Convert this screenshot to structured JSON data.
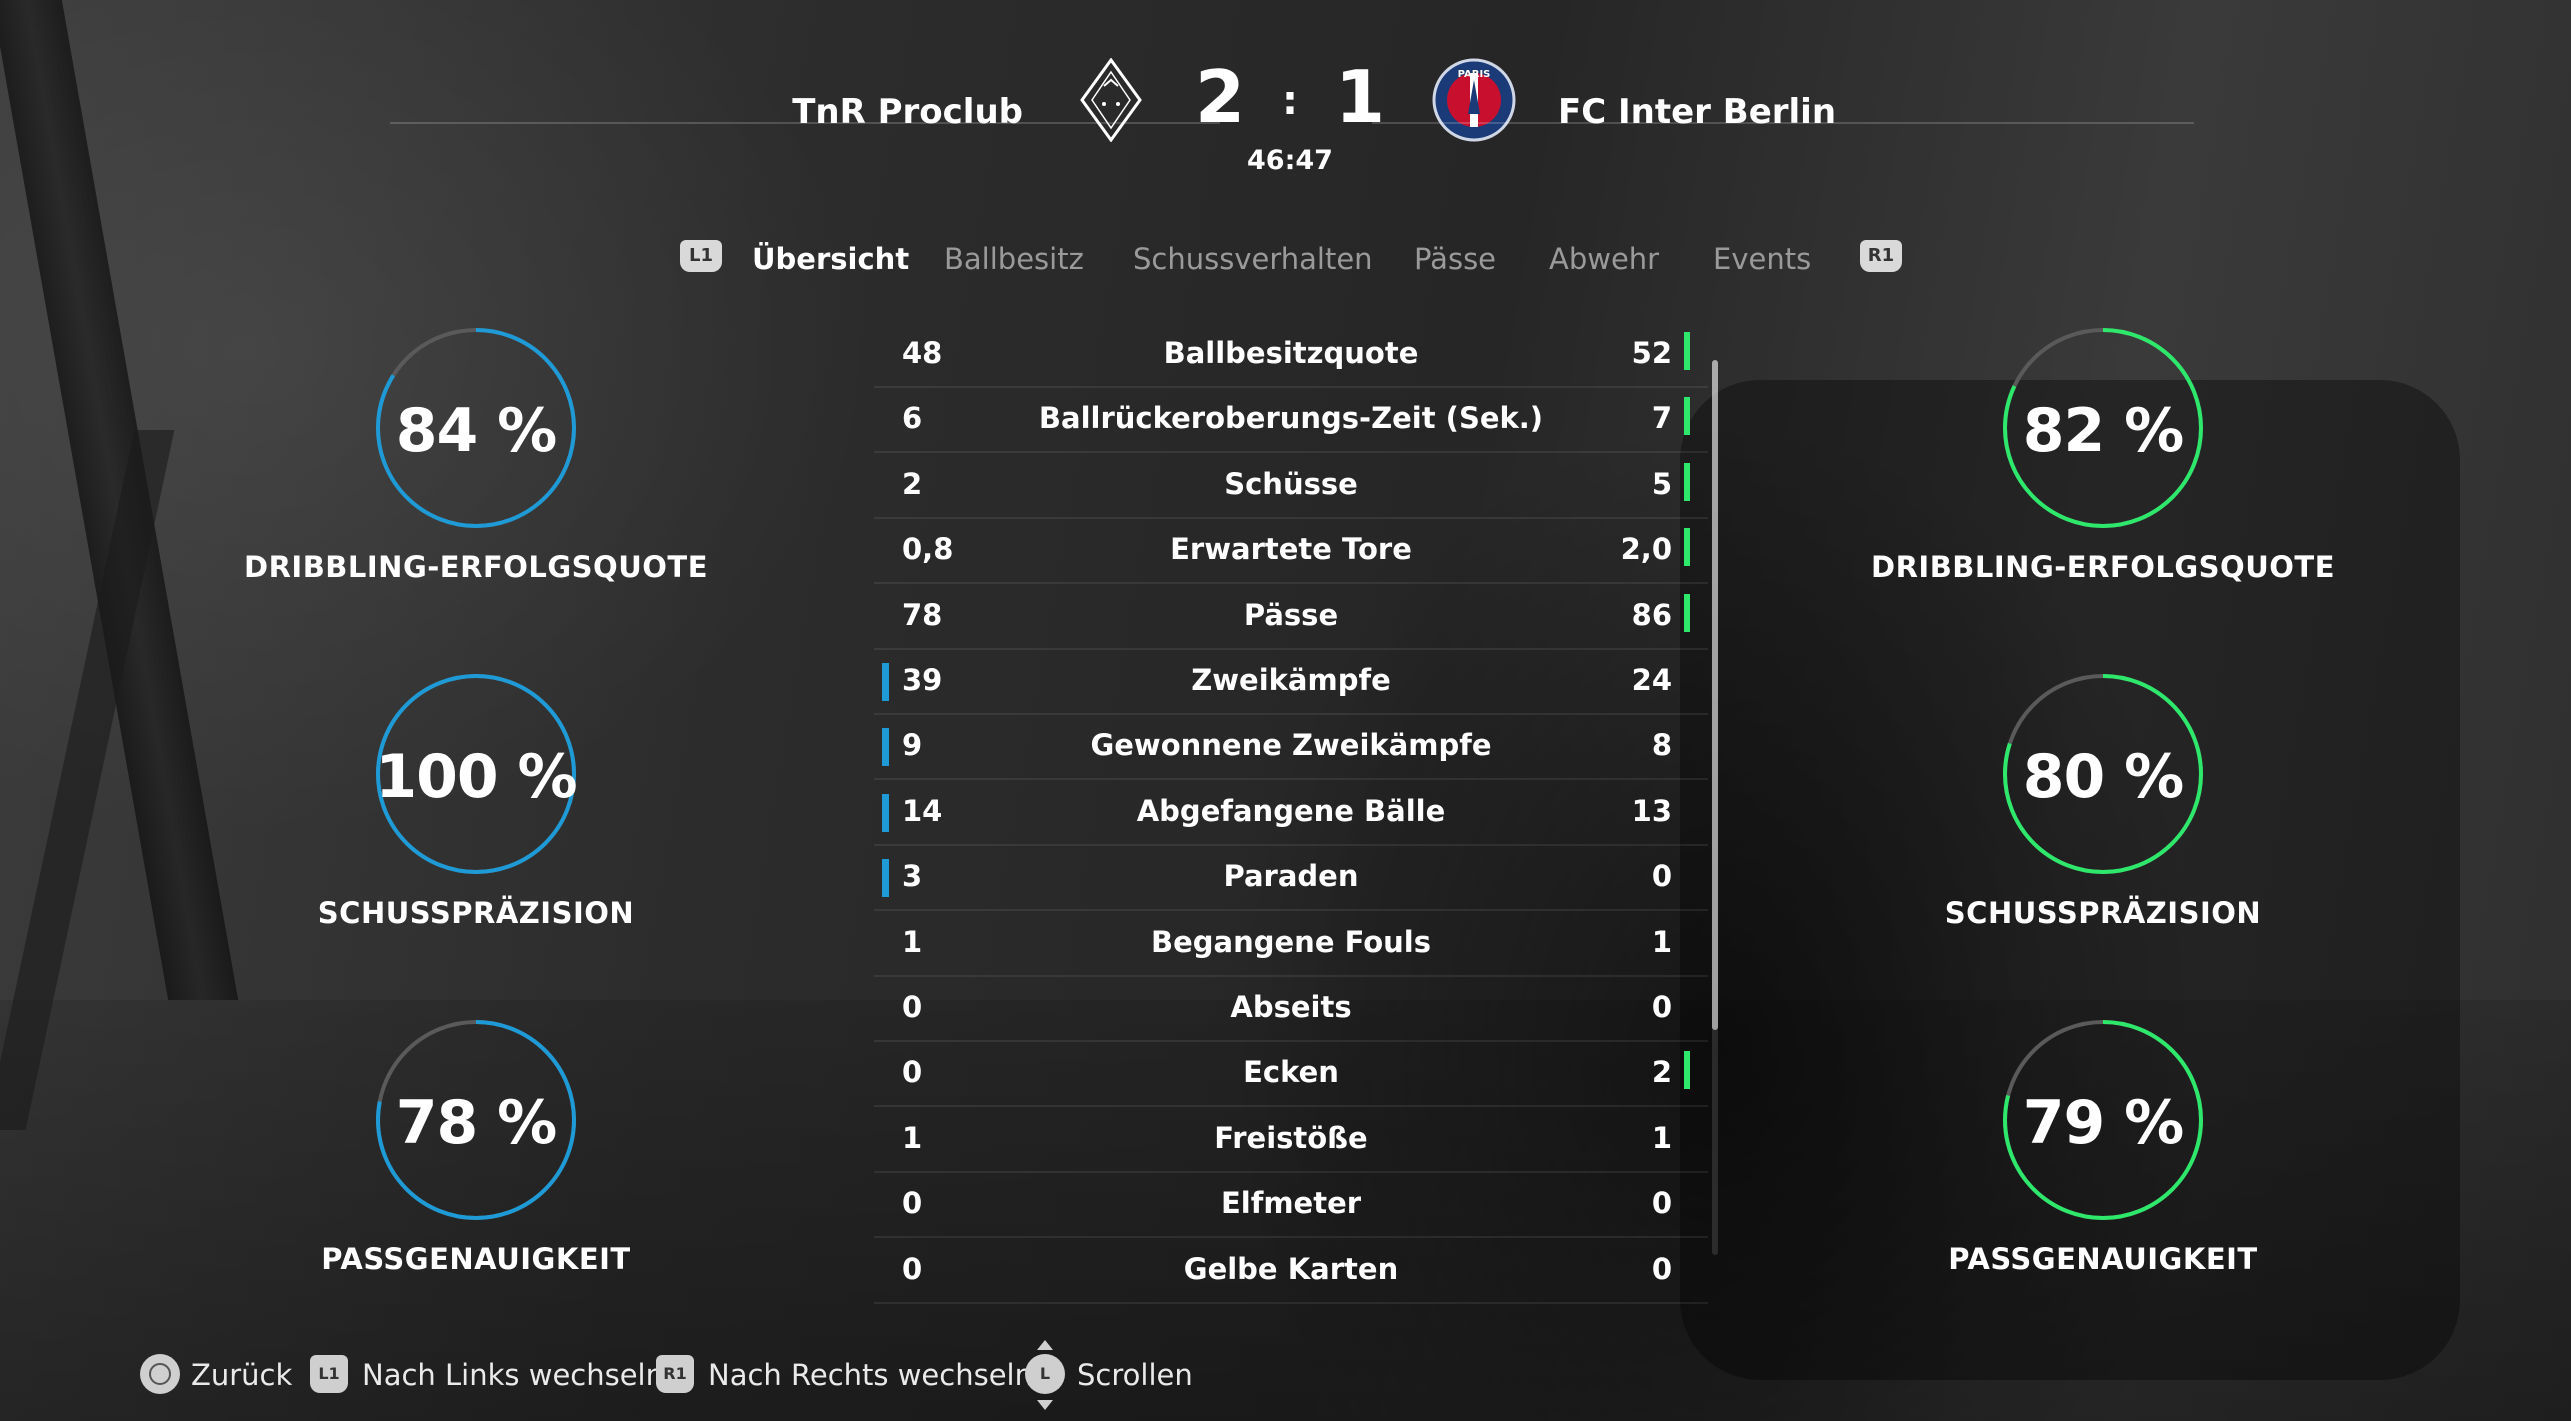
{
  "match": {
    "home_team": "TnR Proclub",
    "away_team": "FC Inter Berlin",
    "home_score": "2",
    "separator": ":",
    "away_score": "1",
    "time": "46:47",
    "home_crest": "diamond-crest-icon",
    "away_crest": "psg-crest-icon",
    "away_crest_text": "PARIS"
  },
  "tabs": {
    "left_button": "L1",
    "right_button": "R1",
    "items": [
      {
        "label": "Übersicht",
        "active": true
      },
      {
        "label": "Ballbesitz",
        "active": false
      },
      {
        "label": "Schussverhalten",
        "active": false
      },
      {
        "label": "Pässe",
        "active": false
      },
      {
        "label": "Abwehr",
        "active": false
      },
      {
        "label": "Events",
        "active": false
      }
    ]
  },
  "home_gauges": [
    {
      "value": "84 %",
      "percent": 84,
      "label": "DRIBBLING-ERFOLGSQUOTE"
    },
    {
      "value": "100 %",
      "percent": 100,
      "label": "SCHUSSPRÄZISION"
    },
    {
      "value": "78 %",
      "percent": 78,
      "label": "PASSGENAUIGKEIT"
    }
  ],
  "away_gauges": [
    {
      "value": "82 %",
      "percent": 82,
      "label": "DRIBBLING-ERFOLGSQUOTE"
    },
    {
      "value": "80 %",
      "percent": 80,
      "label": "SCHUSSPRÄZISION"
    },
    {
      "value": "79 %",
      "percent": 79,
      "label": "PASSGENAUIGKEIT"
    }
  ],
  "stats": [
    {
      "home": "48",
      "label": "Ballbesitzquote",
      "away": "52",
      "leader": "away"
    },
    {
      "home": "6",
      "label": "Ballrückeroberungs-Zeit (Sek.)",
      "away": "7",
      "leader": "away"
    },
    {
      "home": "2",
      "label": "Schüsse",
      "away": "5",
      "leader": "away"
    },
    {
      "home": "0,8",
      "label": "Erwartete Tore",
      "away": "2,0",
      "leader": "away"
    },
    {
      "home": "78",
      "label": "Pässe",
      "away": "86",
      "leader": "away"
    },
    {
      "home": "39",
      "label": "Zweikämpfe",
      "away": "24",
      "leader": "home"
    },
    {
      "home": "9",
      "label": "Gewonnene Zweikämpfe",
      "away": "8",
      "leader": "home"
    },
    {
      "home": "14",
      "label": "Abgefangene Bälle",
      "away": "13",
      "leader": "home"
    },
    {
      "home": "3",
      "label": "Paraden",
      "away": "0",
      "leader": "home"
    },
    {
      "home": "1",
      "label": "Begangene Fouls",
      "away": "1",
      "leader": "none"
    },
    {
      "home": "0",
      "label": "Abseits",
      "away": "0",
      "leader": "none"
    },
    {
      "home": "0",
      "label": "Ecken",
      "away": "2",
      "leader": "away"
    },
    {
      "home": "1",
      "label": "Freistöße",
      "away": "1",
      "leader": "none"
    },
    {
      "home": "0",
      "label": "Elfmeter",
      "away": "0",
      "leader": "none"
    },
    {
      "home": "0",
      "label": "Gelbe Karten",
      "away": "0",
      "leader": "none"
    }
  ],
  "colors": {
    "home_accent": "#1e9bd7",
    "away_accent": "#2ee86b",
    "gauge_track": "#5a5a5a"
  },
  "footer": {
    "back_icon": "circle-button-icon",
    "back_label": "Zurück",
    "left_button": "L1",
    "left_label": "Nach Links wechseln",
    "right_button": "R1",
    "right_label": "Nach Rechts wechseln",
    "scroll_button": "L",
    "scroll_label": "Scrollen"
  }
}
